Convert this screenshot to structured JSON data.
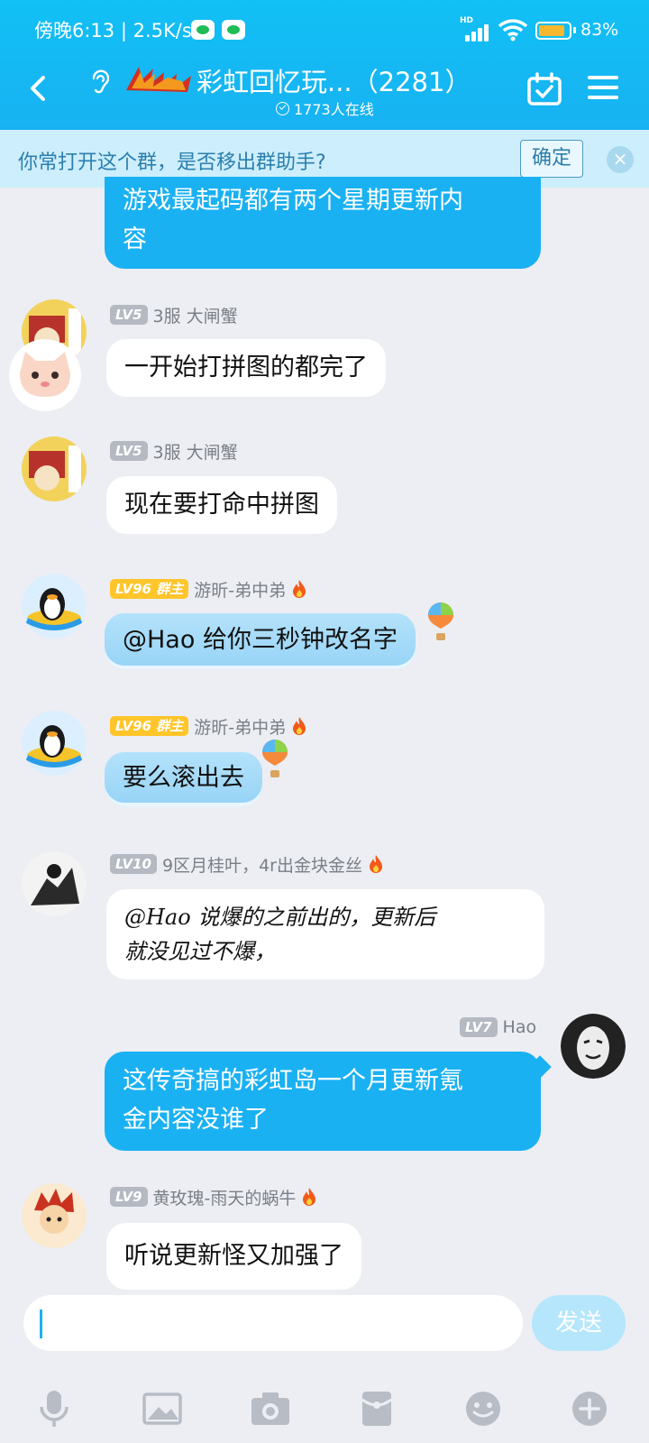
{
  "status_bar": {
    "time_speed": "傍晚6:13 | 2.5K/s",
    "hd": "HD",
    "battery": "83%",
    "battery_level": 0.83
  },
  "header": {
    "title": "彩虹回忆玩...（2281）",
    "online": "1773人在线"
  },
  "banner": {
    "text": "你常打开这个群，是否移出群助手?",
    "confirm": "确定",
    "close": "×"
  },
  "messages": [
    {
      "text_lines": [
        "游戏最起码都有两个星期更新内",
        "容"
      ]
    },
    {
      "level": "LV5",
      "name": "3服 大闸蟹",
      "text": "一开始打拼图的都完了"
    },
    {
      "level": "LV5",
      "name": "3服 大闸蟹",
      "text": "现在要打命中拼图"
    },
    {
      "level": "LV96",
      "role": "群主",
      "name": "游昕-弟中弟",
      "text": "@Hao 给你三秒钟改名字"
    },
    {
      "level": "LV96",
      "role": "群主",
      "name": "游昕-弟中弟",
      "text": "要么滚出去"
    },
    {
      "level": "LV10",
      "name": "9区月桂叶，4r出金块金丝",
      "text_lines": [
        "@Hao 说爆的之前出的，更新后",
        "就没见过不爆，"
      ]
    },
    {
      "level": "LV7",
      "name": "Hao",
      "text_lines": [
        "这传奇搞的彩虹岛一个月更新氪",
        "金内容没谁了"
      ]
    },
    {
      "level": "LV9",
      "name": "黄玫瑰-雨天的蜗牛",
      "text": "听说更新怪又加强了"
    }
  ],
  "input": {
    "placeholder": "",
    "send": "发送"
  },
  "colors": {
    "header": "#11c0f5",
    "accent": "#1ab1f3",
    "owner_badge": "#ffc52a"
  }
}
